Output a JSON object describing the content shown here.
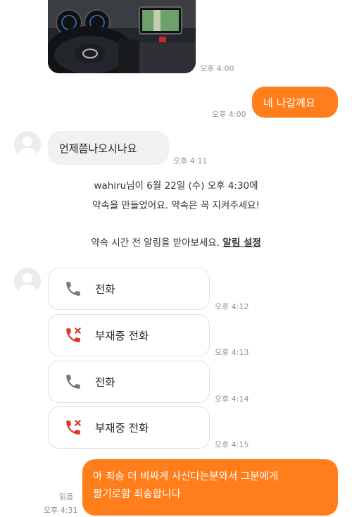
{
  "messages": {
    "photo_time": "오후 4:00",
    "out1": {
      "text": "네 나갈께요",
      "time": "오후 4:00"
    },
    "in1": {
      "text": "언제쯤나오시나요",
      "time": "오후 4:11"
    },
    "notice": {
      "line1": "wahiru님이 6월 22일 (수) 오후 4:30에",
      "line2": "약속을 만들었어요. 약속은 꼭 지켜주세요!",
      "line3": "약속 시간 전 알림을 받아보세요.",
      "link": "알림 설정"
    },
    "calls": [
      {
        "type": "call",
        "label": "전화",
        "time": "오후 4:12",
        "icon": "phone-icon",
        "color": "#777777"
      },
      {
        "type": "missed",
        "label": "부재중 전화",
        "time": "오후 4:13",
        "icon": "missed-call-icon",
        "color": "#d9352b"
      },
      {
        "type": "call",
        "label": "전화",
        "time": "오후 4:14",
        "icon": "phone-icon",
        "color": "#777777"
      },
      {
        "type": "missed",
        "label": "부재중 전화",
        "time": "오후 4:15",
        "icon": "missed-call-icon",
        "color": "#d9352b"
      }
    ],
    "out2": {
      "line1": "아 죄송 더 비싸게 사신다는분와서 그분에게",
      "line2": "팔기로함 죄송합니다",
      "read": "읽음",
      "time": "오후 4:31"
    }
  },
  "colors": {
    "accent": "#ff7d1a",
    "missed": "#d9352b",
    "bubble_in": "#f1f1f3"
  }
}
